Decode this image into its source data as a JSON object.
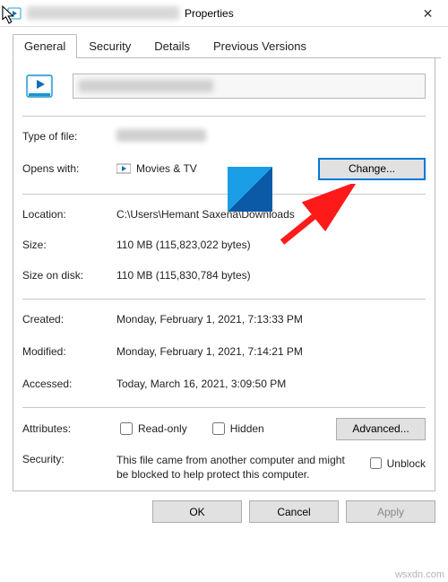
{
  "titlebar": {
    "title_suffix": "Properties"
  },
  "tabs": {
    "general": "General",
    "security": "Security",
    "details": "Details",
    "previous_versions": "Previous Versions"
  },
  "labels": {
    "type_of_file": "Type of file:",
    "opens_with": "Opens with:",
    "location": "Location:",
    "size": "Size:",
    "size_on_disk": "Size on disk:",
    "created": "Created:",
    "modified": "Modified:",
    "accessed": "Accessed:",
    "attributes": "Attributes:",
    "security": "Security:"
  },
  "values": {
    "opens_with_app": "Movies & TV",
    "location": "C:\\Users\\Hemant Saxena\\Downloads",
    "size": "110 MB (115,823,022 bytes)",
    "size_on_disk": "110 MB (115,830,784 bytes)",
    "created": "Monday, February 1, 2021, 7:13:33 PM",
    "modified": "Monday, February 1, 2021, 7:14:21 PM",
    "accessed": "Today, March 16, 2021, 3:09:50 PM"
  },
  "buttons": {
    "change": "Change...",
    "advanced": "Advanced...",
    "ok": "OK",
    "cancel": "Cancel",
    "apply": "Apply"
  },
  "attributes": {
    "readonly": "Read-only",
    "hidden": "Hidden"
  },
  "security": {
    "message": "This file came from another computer and might be blocked to help protect this computer.",
    "unblock": "Unblock"
  },
  "watermark": "wsxdn.com"
}
